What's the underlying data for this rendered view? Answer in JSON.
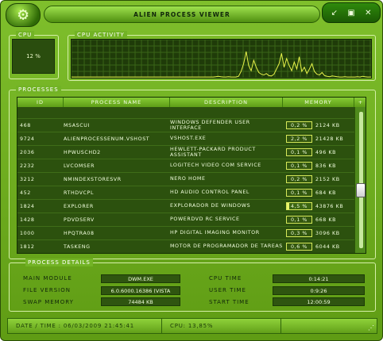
{
  "window": {
    "title": "ALIEN PROCESS VIEWER",
    "logo_icon": "gear-icon",
    "buttons": [
      {
        "name": "minimize-button",
        "icon": "arrow-down-left-icon",
        "glyph": "↙"
      },
      {
        "name": "maximize-button",
        "icon": "square-icon",
        "glyph": "▣"
      },
      {
        "name": "close-button",
        "icon": "close-icon",
        "glyph": "✕"
      }
    ]
  },
  "cpu": {
    "label": "CPU",
    "value": "12 %"
  },
  "cpu_activity": {
    "label": "CPU ACTIVITY"
  },
  "processes": {
    "label": "PROCESSES",
    "headers": {
      "id": "ID",
      "name": "PROCESS NAME",
      "description": "DESCRIPTION",
      "memory": "MEMORY",
      "add": "+"
    },
    "rows": [
      {
        "id": "468",
        "name": "MSASCUI",
        "description": "WINDOWS DEFENDER USER INTERFACE",
        "pct": "0,2 %",
        "kb": "2124 KB"
      },
      {
        "id": "9724",
        "name": "ALIENPROCESSENUM.VSHOST",
        "description": "VSHOST.EXE",
        "pct": "2,2 %",
        "kb": "21428 KB"
      },
      {
        "id": "2036",
        "name": "HPWUSCHD2",
        "description": "HEWLETT-PACKARD PRODUCT ASSISTANT",
        "pct": "0,1 %",
        "kb": "496 KB"
      },
      {
        "id": "2232",
        "name": "LVCOMSER",
        "description": "LOGITECH VIDEO COM SERVICE",
        "pct": "0,1 %",
        "kb": "836 KB"
      },
      {
        "id": "3212",
        "name": "NMINDEXSTORESVR",
        "description": "NERO HOME",
        "pct": "0,2 %",
        "kb": "2152 KB"
      },
      {
        "id": "452",
        "name": "RTHDVCPL",
        "description": "HD AUDIO CONTROL PANEL",
        "pct": "0,1 %",
        "kb": "684 KB"
      },
      {
        "id": "1824",
        "name": "EXPLORER",
        "description": "EXPLORADOR DE WINDOWS",
        "pct": "4,5 %",
        "kb": "43876 KB"
      },
      {
        "id": "1428",
        "name": "PDVDSERV",
        "description": "POWERDVD RC SERVICE",
        "pct": "0,1 %",
        "kb": "668 KB"
      },
      {
        "id": "1000",
        "name": "HPQTRA08",
        "description": "HP DIGITAL IMAGING MONITOR",
        "pct": "0,3 %",
        "kb": "3096 KB"
      },
      {
        "id": "1812",
        "name": "TASKENG",
        "description": "MOTOR DE PROGRAMADOR DE TAREAS",
        "pct": "0,6 %",
        "kb": "6044 KB"
      }
    ]
  },
  "details": {
    "label": "PROCESS DETAILS",
    "main_module_label": "MAIN MODULE",
    "main_module": "DWM.EXE",
    "file_version_label": "FILE VERSION",
    "file_version": "6.0.6000.16386 (VISTA",
    "swap_memory_label": "SWAP MEMORY",
    "swap_memory": "74484 KB",
    "cpu_time_label": "CPU TIME",
    "cpu_time": "0:14:21",
    "user_time_label": "USER TIME",
    "user_time": "0:9:26",
    "start_time_label": "START TIME",
    "start_time": "12:00:59"
  },
  "status": {
    "datetime": "DATE / TIME : 06/03/2009 21:45:41",
    "cpu": "CPU: 13,85%",
    "grip_icon": "resize-grip-icon"
  },
  "colors": {
    "accent": "#7fbf2c",
    "panel": "#2c510e",
    "graph_line": "#e6f24a"
  },
  "cpu_history": [
    2,
    2,
    2,
    2,
    2,
    2,
    2,
    2,
    2,
    2,
    2,
    2,
    2,
    2,
    2,
    2,
    2,
    2,
    2,
    2,
    2,
    2,
    2,
    2,
    2,
    2,
    2,
    2,
    2,
    2,
    2,
    2,
    2,
    2,
    2,
    2,
    2,
    2,
    2,
    2,
    2,
    2,
    2,
    2,
    2,
    2,
    2,
    2,
    2,
    2,
    2,
    2,
    2,
    2,
    2,
    2,
    2,
    3,
    4,
    3,
    2,
    2,
    3,
    2,
    2,
    2,
    4,
    18,
    40,
    75,
    35,
    20,
    50,
    30,
    15,
    10,
    8,
    12,
    6,
    5,
    10,
    25,
    40,
    70,
    30,
    55,
    35,
    20,
    45,
    25,
    60,
    18,
    30,
    12,
    25,
    40,
    18,
    10,
    8,
    15,
    6,
    4,
    3,
    5,
    4,
    3,
    2,
    2,
    3,
    2,
    2,
    2,
    2,
    3,
    2,
    4,
    3,
    2,
    2,
    2
  ]
}
